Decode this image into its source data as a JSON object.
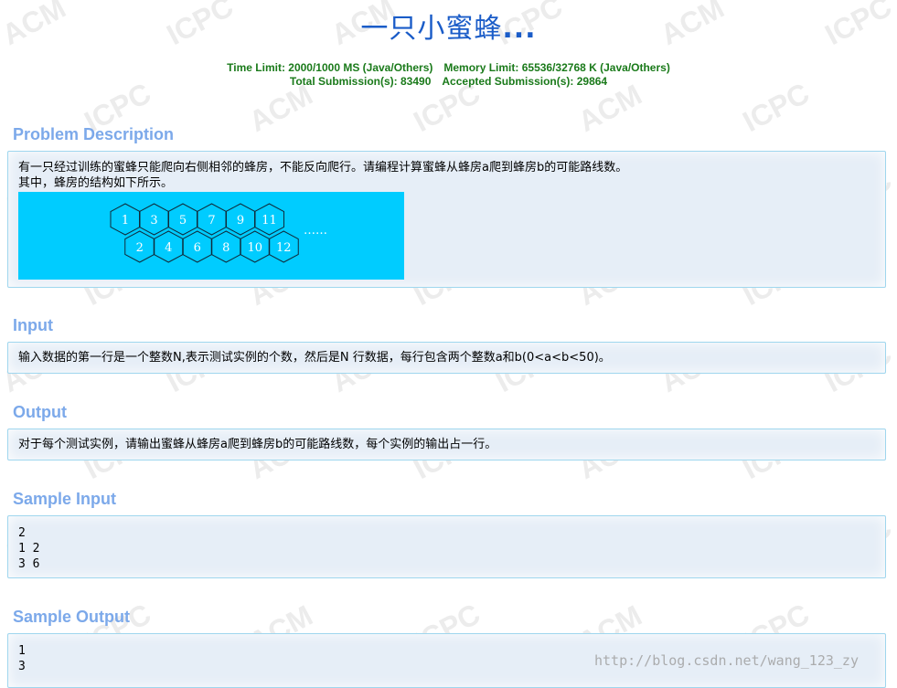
{
  "problem": {
    "title_main": "一只小蜜蜂",
    "title_dots": "...",
    "time_limit": "Time Limit: 2000/1000 MS (Java/Others)",
    "memory_limit": "Memory Limit: 65536/32768 K (Java/Others)",
    "total_submissions": "Total Submission(s): 83490",
    "accepted_submissions": "Accepted Submission(s): 29864"
  },
  "sections": {
    "description": {
      "heading": "Problem Description",
      "line1": "有一只经过训练的蜜蜂只能爬向右侧相邻的蜂房，不能反向爬行。请编程计算蜜蜂从蜂房a爬到蜂房b的可能路线数。",
      "line2": "其中，蜂房的结构如下所示。"
    },
    "input": {
      "heading": "Input",
      "text": "输入数据的第一行是一个整数N,表示测试实例的个数，然后是N 行数据，每行包含两个整数a和b(0<a<b<50)。"
    },
    "output": {
      "heading": "Output",
      "text": "对于每个测试实例，请输出蜜蜂从蜂房a爬到蜂房b的可能路线数，每个实例的输出占一行。"
    },
    "sample_input": {
      "heading": "Sample Input",
      "lines": [
        "2",
        "1 2",
        "3 6"
      ]
    },
    "sample_output": {
      "heading": "Sample Output",
      "lines": [
        "1",
        "3"
      ]
    }
  },
  "hive_figure": {
    "top_cells": [
      "1",
      "3",
      "5",
      "7",
      "9",
      "11"
    ],
    "bottom_cells": [
      "2",
      "4",
      "6",
      "8",
      "10",
      "12"
    ],
    "ellipsis": "……",
    "background_color": "#00ccff"
  },
  "watermark": {
    "acm_text": "ACM",
    "icpc_text": "ICPC"
  },
  "credit": {
    "url": "http://blog.csdn.net/wang_123_zy"
  },
  "colors": {
    "title": "#1a5cc8",
    "limits": "#1a7a1a",
    "section_heading": "#7ca9ea",
    "panel_bg": "#e6eef7",
    "panel_border": "#9fd6ee"
  }
}
